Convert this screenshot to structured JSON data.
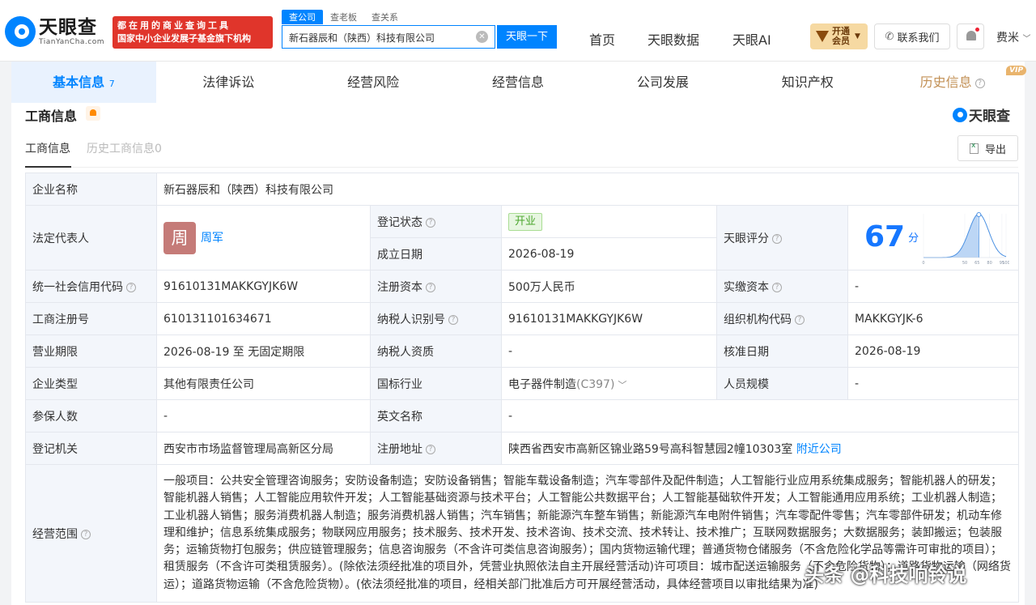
{
  "header": {
    "logo_cn": "天眼查",
    "logo_en": "TianYanCha.com",
    "promo_line1": "都在用的商业查询工具",
    "promo_line2": "国家中小企业发展子基金旗下机构",
    "search_tabs": [
      "查公司",
      "查老板",
      "查关系"
    ],
    "search_value": "新石器辰和（陕西）科技有限公司",
    "search_button": "天眼一下",
    "nav": [
      "首页",
      "天眼数据",
      "天眼AI"
    ],
    "vip_label": "开通会员",
    "contact_label": "联系我们",
    "user_name": "费米"
  },
  "tabs": [
    {
      "label": "基本信息",
      "count": "7"
    },
    {
      "label": "法律诉讼"
    },
    {
      "label": "经营风险"
    },
    {
      "label": "经营信息"
    },
    {
      "label": "公司发展"
    },
    {
      "label": "知识产权"
    },
    {
      "label": "历史信息",
      "badge": "VIP"
    }
  ],
  "section": {
    "title": "工商信息",
    "brand": "天眼查",
    "sub_tabs": [
      "工商信息",
      "历史工商信息0"
    ],
    "export_label": "导出"
  },
  "info": {
    "company_name_label": "企业名称",
    "company_name": "新石器辰和（陕西）科技有限公司",
    "legal_rep_label": "法定代表人",
    "legal_rep_avatar": "周",
    "legal_rep": "周军",
    "reg_status_label": "登记状态",
    "reg_status": "开业",
    "founded_label": "成立日期",
    "founded": "2026-08-19",
    "rating_label": "天眼评分",
    "score": "67",
    "score_unit": "分",
    "credit_code_label": "统一社会信用代码",
    "credit_code": "91610131MAKKGYJK6W",
    "reg_capital_label": "注册资本",
    "reg_capital": "500万人民币",
    "paid_capital_label": "实缴资本",
    "paid_capital": "-",
    "reg_no_label": "工商注册号",
    "reg_no": "610131101634671",
    "taxpayer_id_label": "纳税人识别号",
    "taxpayer_id": "91610131MAKKGYJK6W",
    "org_code_label": "组织机构代码",
    "org_code": "MAKKGYJK-6",
    "term_label": "营业期限",
    "term": "2026-08-19 至 无固定期限",
    "taxpayer_qual_label": "纳税人资质",
    "taxpayer_qual": "-",
    "approve_date_label": "核准日期",
    "approve_date": "2026-08-19",
    "ent_type_label": "企业类型",
    "ent_type": "其他有限责任公司",
    "industry_label": "国标行业",
    "industry": "电子器件制造",
    "industry_code": "(C397)",
    "staff_size_label": "人员规模",
    "staff_size": "-",
    "insured_label": "参保人数",
    "insured": "-",
    "english_name_label": "英文名称",
    "english_name": "-",
    "authority_label": "登记机关",
    "authority": "西安市市场监督管理局高新区分局",
    "address_label": "注册地址",
    "address": "陕西省西安市高新区锦业路59号高科智慧园2幢10303室",
    "nearby_label": "附近公司",
    "scope_label": "经营范围",
    "scope": "一般项目：公共安全管理咨询服务；安防设备制造；安防设备销售；智能车载设备制造；汽车零部件及配件制造；人工智能行业应用系统集成服务；智能机器人的研发；智能机器人销售；人工智能应用软件开发；人工智能基础资源与技术平台；人工智能公共数据平台；人工智能基础软件开发；人工智能通用应用系统；工业机器人制造；工业机器人销售；服务消费机器人制造；服务消费机器人销售；汽车销售；新能源汽车整车销售；新能源汽车电附件销售；汽车零配件零售；汽车零部件研发；机动车修理和维护；信息系统集成服务；物联网应用服务；技术服务、技术开发、技术咨询、技术交流、技术转让、技术推广；互联网数据服务；大数据服务；装卸搬运；包装服务；运输货物打包服务；供应链管理服务；信息咨询服务（不含许可类信息咨询服务）；国内货物运输代理；普通货物仓储服务（不含危险化学品等需许可审批的项目）；租赁服务（不含许可类租赁服务）。(除依法须经批准的项目外，凭营业执照依法自主开展经营活动)许可项目：城市配送运输服务（不含危险货物）；道路货物运输（网络货运）；道路货物运输（不含危险货物）。(依法须经批准的项目，经相关部门批准后方可开展经营活动，具体经营项目以审批结果为准)"
  },
  "chart_data": {
    "type": "area",
    "x": [
      0,
      50,
      65,
      80,
      95,
      100
    ],
    "ticks": [
      "0",
      "50",
      "65",
      "80",
      "95",
      "100"
    ],
    "highlight": 67,
    "color": "#4a90e2"
  },
  "watermark": "头条 @科技响铃说"
}
